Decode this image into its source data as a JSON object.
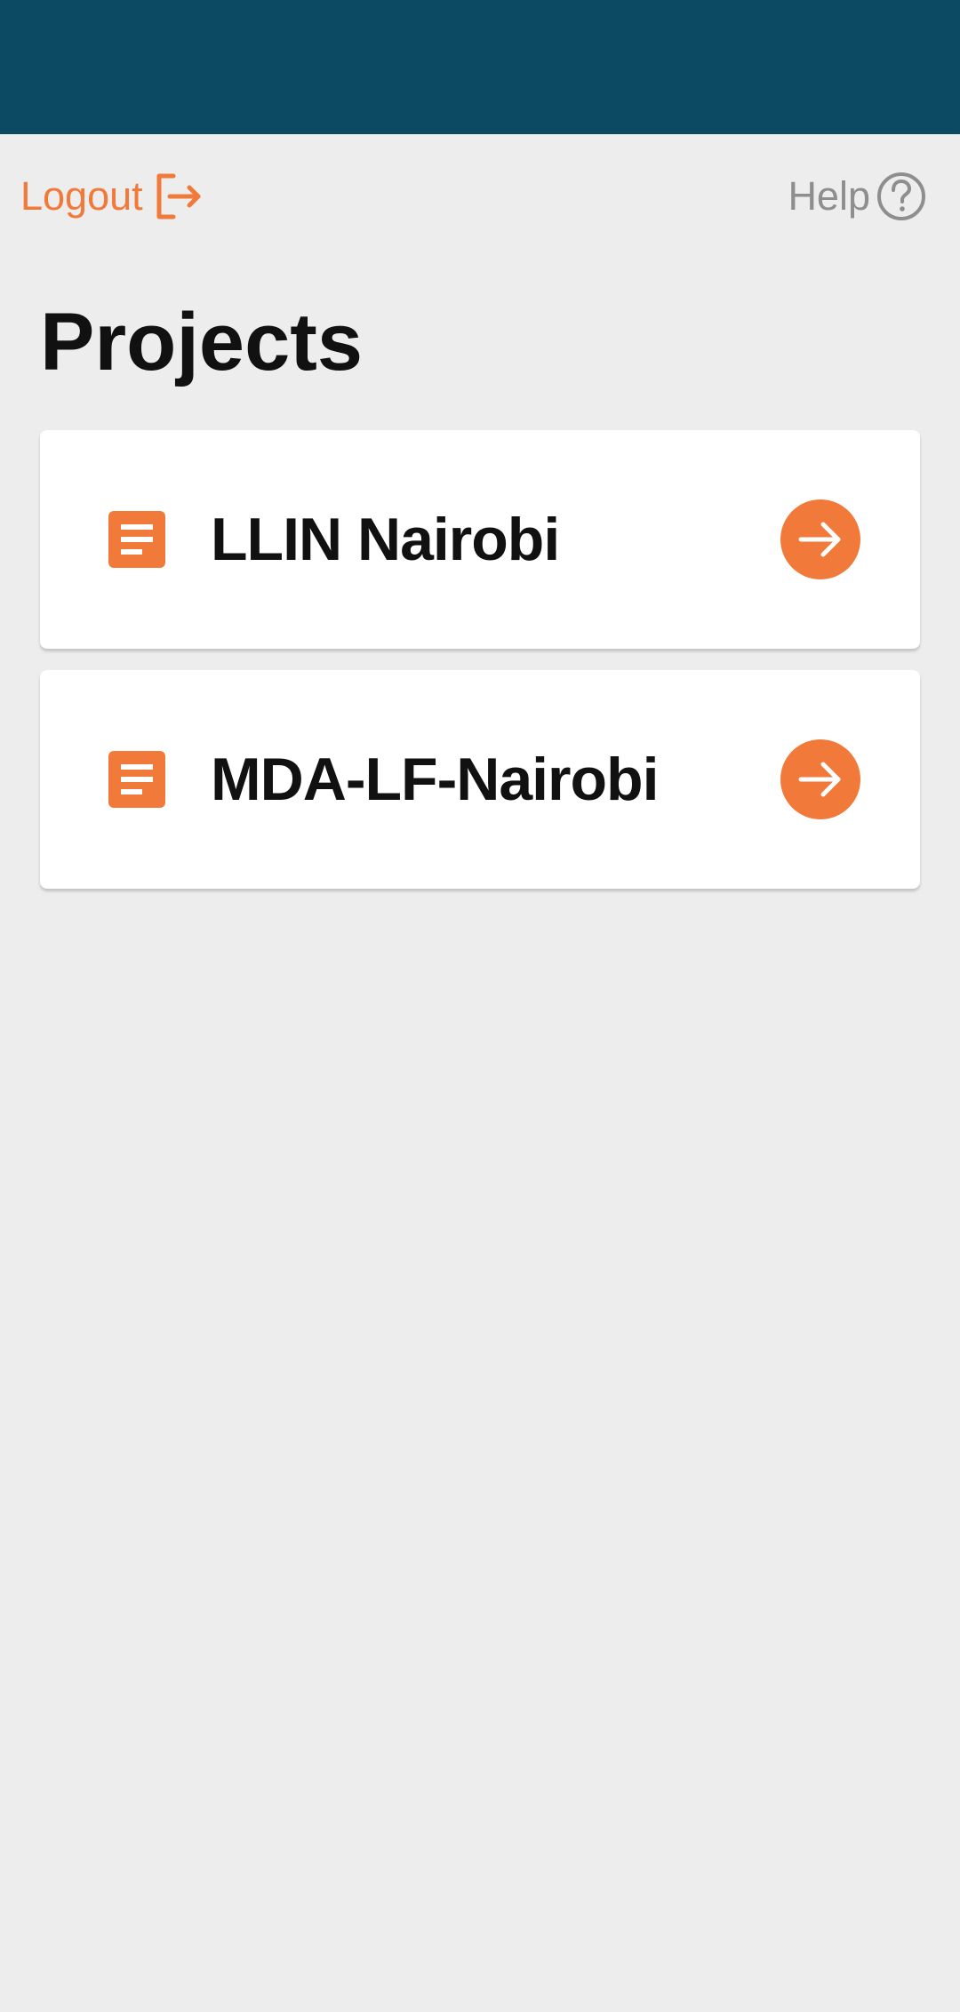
{
  "colors": {
    "status_bar": "#0C4A64",
    "accent": "#F17A3A",
    "background": "#EDEDED",
    "card": "#FFFFFF",
    "muted": "#8E8E8E"
  },
  "header": {
    "logout_label": "Logout",
    "logout_icon": "logout-icon",
    "help_label": "Help",
    "help_icon": "help-circle-icon"
  },
  "page": {
    "title": "Projects"
  },
  "projects": [
    {
      "name": "LLIN Nairobi",
      "icon": "document-icon",
      "action_icon": "arrow-right-icon"
    },
    {
      "name": "MDA-LF-Nairobi",
      "icon": "document-icon",
      "action_icon": "arrow-right-icon"
    }
  ]
}
